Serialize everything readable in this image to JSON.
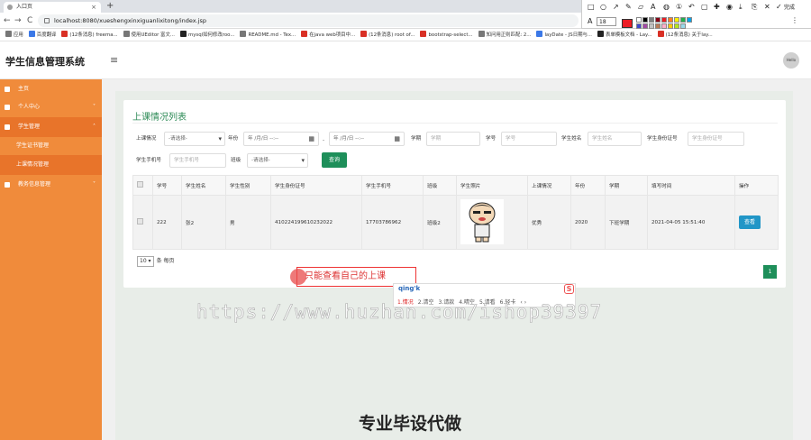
{
  "browser": {
    "tab_title": "入口页",
    "tab_close": "×",
    "new_tab": "+",
    "back": "←",
    "forward": "→",
    "reload": "C",
    "url": "localhost:8080/xueshengxinxiguanlixitong/index.jsp",
    "bookmarks": [
      "应用",
      "百度翻译",
      "(12条消息) freema...",
      "使用UEditor 富文...",
      "mysql如何修改roo...",
      "README.md - Tex...",
      "在java web项目中...",
      "(12条消息) root of...",
      "bootstrap-select...",
      "知问用正则匹配: 2...",
      "layDate - JS日期与...",
      "表单模板文档 - Lay...",
      "(12条消息) 关于lay..."
    ],
    "draw_font_size": "18",
    "draw_done": "完成",
    "draw_colors": [
      "#ffffff",
      "#000000",
      "#7f7f7f",
      "#880015",
      "#ed1c24",
      "#ff7f27",
      "#fff200",
      "#22b14c",
      "#00a2e8",
      "#3f48cc",
      "#a349a4",
      "#c3c3c3",
      "#b97a57",
      "#ffaec9",
      "#ffc90e",
      "#b5e61d",
      "#99d9ea"
    ]
  },
  "app": {
    "title": "学生信息管理系统",
    "menu_icon": "≡",
    "user_avatar_text": "Hello"
  },
  "sidebar": {
    "items": [
      {
        "label": "主页"
      },
      {
        "label": "个人中心"
      },
      {
        "label": "学生管理"
      },
      {
        "label": "学生证书管理"
      },
      {
        "label": "上课情况管理"
      },
      {
        "label": "教务信息管理"
      }
    ]
  },
  "page": {
    "title": "上课情况列表",
    "filters": {
      "attendance_label": "上课情况",
      "attendance_value": "-请选择-",
      "year_label": "年份",
      "date_start_placeholder": "年 /月/日 --:--",
      "date_sep": "-",
      "date_end_placeholder": "年 /月/日 --:--",
      "semester_label": "学期",
      "semester_placeholder": "学期",
      "student_no_label": "学号",
      "student_no_placeholder": "学号",
      "student_name_label": "学生姓名",
      "student_name_placeholder": "学生姓名",
      "id_label": "学生身份证号",
      "id_placeholder": "学生身份证号",
      "phone_label": "学生手机号",
      "phone_placeholder": "学生手机号",
      "class_label": "班级",
      "class_value": "-请选择-",
      "search_button": "查询"
    },
    "table": {
      "headers": [
        "",
        "学号",
        "学生姓名",
        "学生性别",
        "学生身份证号",
        "学生手机号",
        "班级",
        "学生照片",
        "上课情况",
        "年份",
        "学期",
        "填写时间",
        "操作"
      ],
      "rows": [
        {
          "student_no": "222",
          "name": "张2",
          "gender": "男",
          "id_card": "410224199610232022",
          "phone": "17703786962",
          "class": "班级2",
          "attendance": "优秀",
          "year": "2020",
          "semester": "下班学期",
          "filled_at": "2021-04-05 15:51:40",
          "action": "查看"
        }
      ]
    },
    "pagination": {
      "page_size": "10",
      "page_size_suffix": "条 每页",
      "current_page": "1"
    }
  },
  "annotation": {
    "text": "只能查看自己的上课"
  },
  "ime": {
    "pinyin": "qing'k",
    "candidates": [
      "1.情况",
      "2.清空",
      "3.请款",
      "4.晴空",
      "5.请看",
      "6.轻卡"
    ],
    "more": "‹ ›",
    "logo": "S"
  },
  "watermark": "https://www.huzhan.com/ishop39397",
  "promo": "专业毕设代做"
}
